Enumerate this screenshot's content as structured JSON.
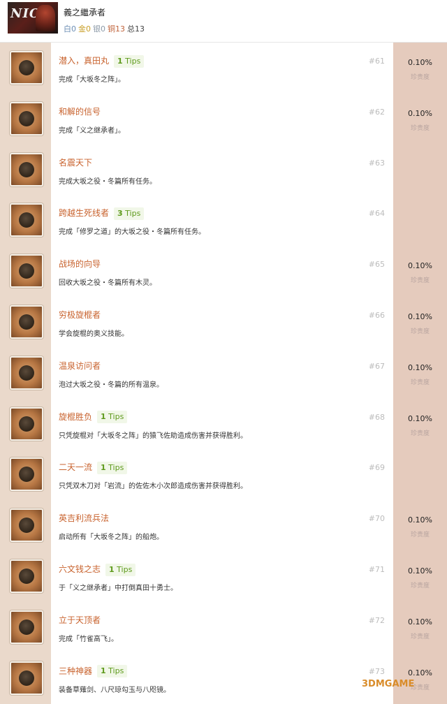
{
  "header": {
    "game_title": "義之繼承者",
    "cover_logo": "NIOH",
    "counts": {
      "white": "白0",
      "gold": "金0",
      "silver": "银0",
      "bronze": "铜13",
      "total": "总13"
    }
  },
  "rarity_label": "珍贵度",
  "trophies": [
    {
      "name": "潜入，真田丸",
      "tips": "1",
      "desc": "完成「大坂冬之阵」。",
      "num": "#61",
      "rate": "0.10%",
      "has_rate": true
    },
    {
      "name": "和解的信号",
      "tips": "",
      "desc": "完成「义之继承者」。",
      "num": "#62",
      "rate": "0.10%",
      "has_rate": true
    },
    {
      "name": "名震天下",
      "tips": "",
      "desc": "完成大坂之役・冬篇所有任务。",
      "num": "#63",
      "rate": "",
      "has_rate": false
    },
    {
      "name": "跨越生死线者",
      "tips": "3",
      "desc": "完成「修罗之道」的大坂之役・冬篇所有任务。",
      "num": "#64",
      "rate": "",
      "has_rate": false
    },
    {
      "name": "战场的向导",
      "tips": "",
      "desc": "回收大坂之役・冬篇所有木灵。",
      "num": "#65",
      "rate": "0.10%",
      "has_rate": true
    },
    {
      "name": "穷极旋棍者",
      "tips": "",
      "desc": "学会旋棍的奥义技能。",
      "num": "#66",
      "rate": "0.10%",
      "has_rate": true
    },
    {
      "name": "温泉访问者",
      "tips": "",
      "desc": "泡过大坂之役・冬篇的所有温泉。",
      "num": "#67",
      "rate": "0.10%",
      "has_rate": true
    },
    {
      "name": "旋棍胜负",
      "tips": "1",
      "desc": "只凭旋棍对「大坂冬之阵」的猿飞佐助造成伤害并获得胜利。",
      "num": "#68",
      "rate": "0.10%",
      "has_rate": true
    },
    {
      "name": "二天一流",
      "tips": "1",
      "desc": "只凭双木刀对「岩流」的佐佐木小次郎造成伤害并获得胜利。",
      "num": "#69",
      "rate": "",
      "has_rate": false
    },
    {
      "name": "英吉利流兵法",
      "tips": "",
      "desc": "启动所有「大坂冬之阵」的船炮。",
      "num": "#70",
      "rate": "0.10%",
      "has_rate": true
    },
    {
      "name": "六文钱之志",
      "tips": "1",
      "desc": "于「义之继承者」中打倒真田十勇士。",
      "num": "#71",
      "rate": "0.10%",
      "has_rate": true
    },
    {
      "name": "立于天顶者",
      "tips": "",
      "desc": "完成「竹雀高飞」。",
      "num": "#72",
      "rate": "0.10%",
      "has_rate": true
    },
    {
      "name": "三种神器",
      "tips": "1",
      "desc": "装备草薙剑、八尺琼勾玉与八咫镜。",
      "num": "#73",
      "rate": "0.10%",
      "has_rate": true
    }
  ],
  "tips_word": "Tips",
  "watermark": "3DMGAME"
}
